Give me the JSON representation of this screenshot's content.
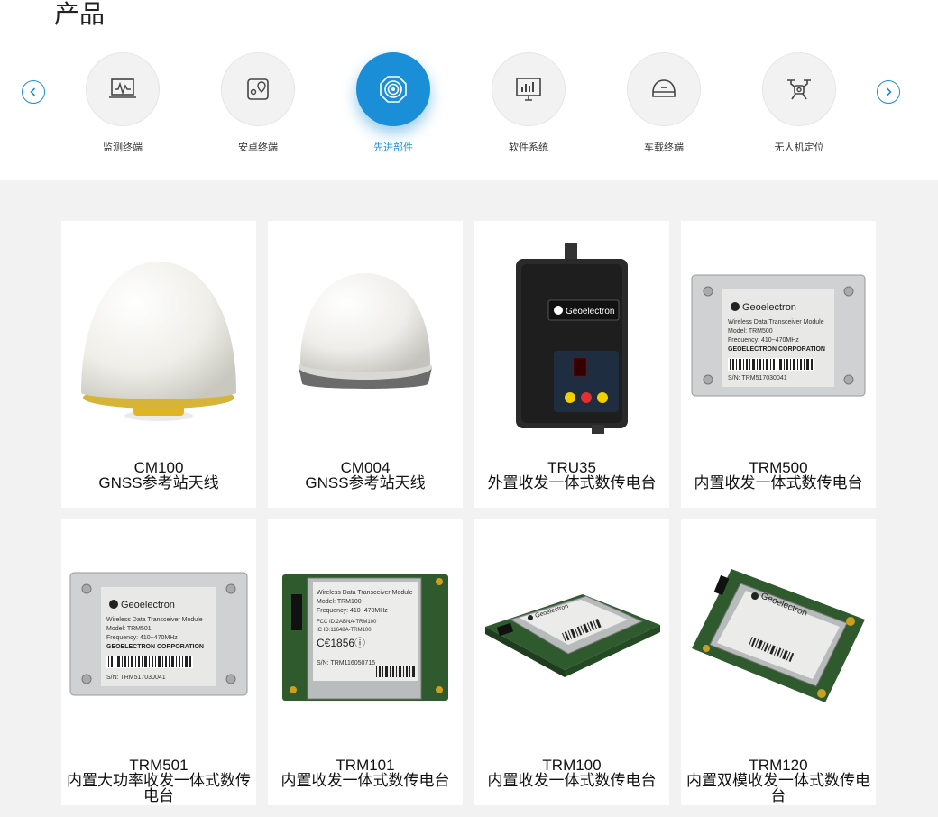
{
  "header": {
    "title": "产品"
  },
  "nav": {
    "prev_icon": "chevron-left-icon",
    "next_icon": "chevron-right-icon",
    "accent_color": "#1a8fd8",
    "categories": [
      {
        "label": "监测终端",
        "icon": "monitor-waveform-icon",
        "active": false
      },
      {
        "label": "安卓终端",
        "icon": "map-pin-icon",
        "active": false
      },
      {
        "label": "先进部件",
        "icon": "radar-target-icon",
        "active": true
      },
      {
        "label": "软件系统",
        "icon": "bar-chart-monitor-icon",
        "active": false
      },
      {
        "label": "车载终端",
        "icon": "vehicle-dome-icon",
        "active": false
      },
      {
        "label": "无人机定位",
        "icon": "drone-icon",
        "active": false
      }
    ]
  },
  "products": [
    {
      "name": "CM100",
      "desc": "GNSS参考站天线",
      "image": "dome-antenna-tall"
    },
    {
      "name": "CM004",
      "desc": "GNSS参考站天线",
      "image": "dome-antenna-flat"
    },
    {
      "name": "TRU35",
      "desc": "外置收发一体式数传电台",
      "image": "radio-box",
      "brand": "Geoelectron"
    },
    {
      "name": "TRM500",
      "desc": "内置收发一体式数传电台",
      "image": "metal-module",
      "brand": "Geoelectron",
      "label_lines": [
        "Wireless Data Transceiver Module",
        "Model: TRM500",
        "Frequency: 410~470MHz",
        "GEOELECTRON CORPORATION",
        "S/N: TRM517030041"
      ]
    },
    {
      "name": "TRM501",
      "desc": "内置大功率收发一体式数传电台",
      "image": "metal-module",
      "brand": "Geoelectron",
      "label_lines": [
        "Wireless Data Transceiver Module",
        "Model: TRM501",
        "Frequency: 410~470MHz",
        "GEOELECTRON CORPORATION",
        "S/N: TRM517030041"
      ]
    },
    {
      "name": "TRM101",
      "desc": "内置收发一体式数传电台",
      "image": "pcb-module",
      "label_lines": [
        "Wireless Data Transceiver Module",
        "Model: TRM100",
        "Frequency: 410~470MHz",
        "FCC ID:2ABNA-TRM100",
        "IC ID:11648A-TRM100",
        "C€1856ⓘ",
        "S/N: TRM116050715"
      ]
    },
    {
      "name": "TRM100",
      "desc": "内置收发一体式数传电台",
      "image": "pcb-module-angled",
      "brand": "Geoelectron"
    },
    {
      "name": "TRM120",
      "desc": "内置双模收发一体式数传电台",
      "image": "pcb-module-tilted",
      "brand": "Geoelectron"
    }
  ]
}
